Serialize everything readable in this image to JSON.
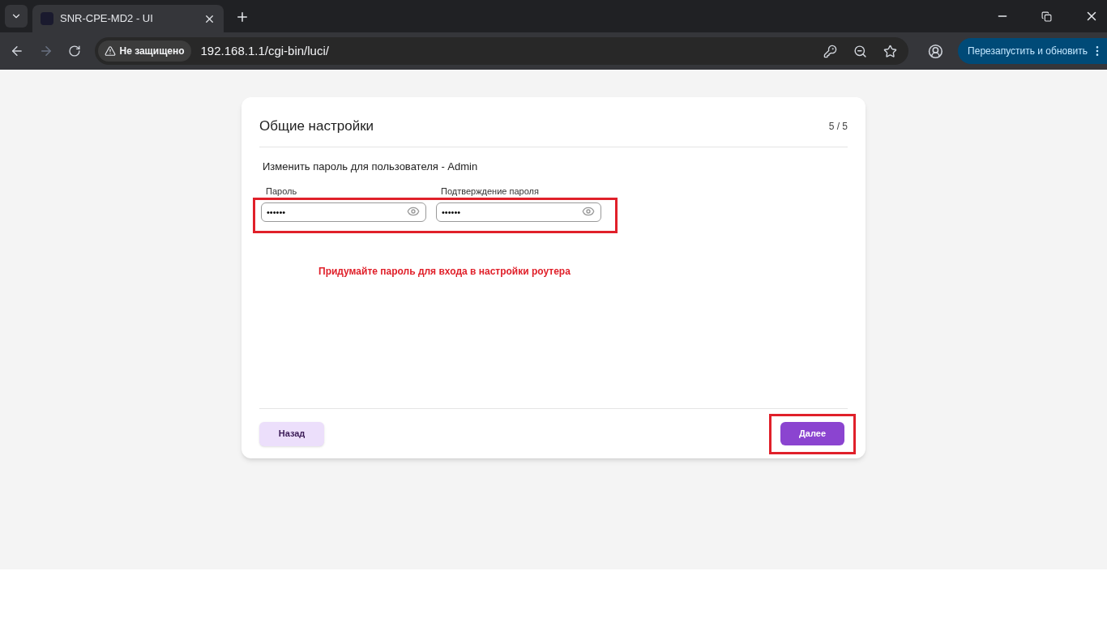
{
  "browser": {
    "tab_title": "SNR-CPE-MD2 - UI",
    "security_label": "Не защищено",
    "url": "192.168.1.1/cgi-bin/luci/",
    "update_button": "Перезапустить и обновить"
  },
  "card": {
    "title": "Общие настройки",
    "step": "5 / 5",
    "subtitle": "Изменить пароль для пользователя - Admin",
    "fields": [
      {
        "label": "Пароль",
        "value": "••••••"
      },
      {
        "label": "Подтверждение пароля",
        "value": "••••••"
      }
    ],
    "annotation": "Придумайте пароль для входа в настройки роутера",
    "back_button": "Назад",
    "next_button": "Далее"
  }
}
